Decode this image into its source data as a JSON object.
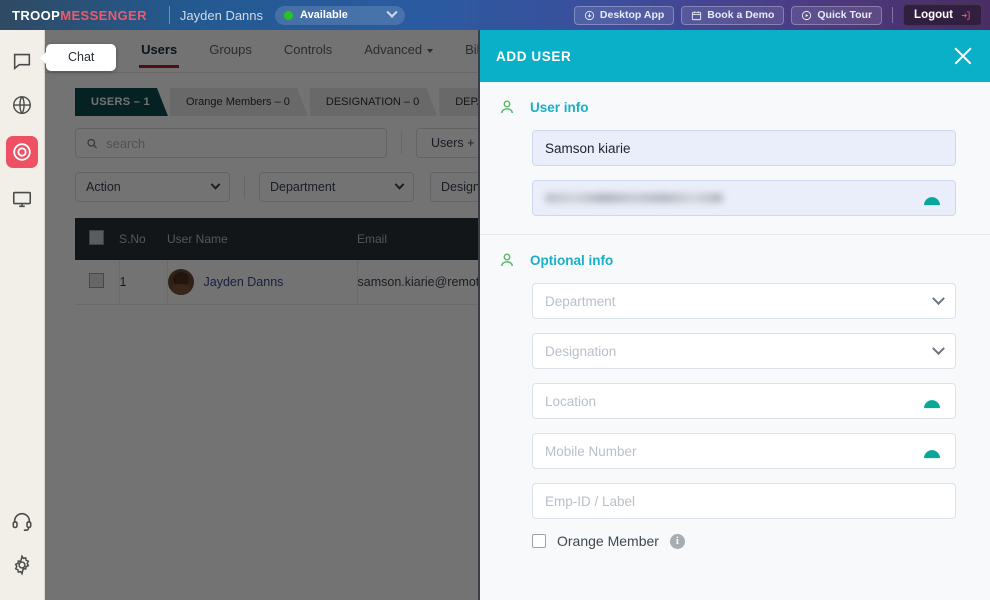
{
  "topbar": {
    "brand_first": "TROOP",
    "brand_second": "MESSENGER",
    "user_name": "Jayden Danns",
    "status": "Available",
    "status_dot_color": "#24c424",
    "buttons": [
      {
        "label": "Desktop App",
        "icon": "download-circle-icon"
      },
      {
        "label": "Book a Demo",
        "icon": "calendar-icon"
      },
      {
        "label": "Quick Tour",
        "icon": "play-circle-icon"
      }
    ],
    "logout_label": "Logout",
    "logout_icon": "logout-icon"
  },
  "rail": {
    "items": [
      {
        "name": "chat",
        "icon": "chat-bubble-icon",
        "active": false
      },
      {
        "name": "globe",
        "icon": "globe-icon",
        "active": false
      },
      {
        "name": "admin",
        "icon": "target-circle-icon",
        "active": true
      },
      {
        "name": "screen",
        "icon": "monitor-icon",
        "active": false
      }
    ],
    "bottom_items": [
      {
        "name": "support",
        "icon": "headset-icon"
      },
      {
        "name": "settings",
        "icon": "gear-icon"
      }
    ],
    "active_color": "#ee5064"
  },
  "tooltip": {
    "label": "Chat"
  },
  "tabs": [
    {
      "label": "Users",
      "active": true,
      "caret": false
    },
    {
      "label": "Groups",
      "active": false,
      "caret": false
    },
    {
      "label": "Controls",
      "active": false,
      "caret": false
    },
    {
      "label": "Advanced",
      "active": false,
      "caret": true
    },
    {
      "label": "Billing",
      "active": false,
      "caret": false
    }
  ],
  "subtabs": [
    {
      "label": "USERS – 1",
      "active": true
    },
    {
      "label": "Orange Members – 0",
      "active": false
    },
    {
      "label": "DESIGNATION – 0",
      "active": false
    },
    {
      "label": "DEPARTMENT –",
      "active": false
    }
  ],
  "filters": {
    "search_placeholder": "search",
    "search_value": "",
    "search_icon": "search-icon",
    "users_add_label": "Users +",
    "selects": [
      {
        "label": "Action"
      },
      {
        "label": "Department"
      },
      {
        "label": "Designation"
      }
    ]
  },
  "table": {
    "columns": [
      "",
      "S.No",
      "User Name",
      "Email"
    ],
    "rows": [
      {
        "sno": "1",
        "user_name": "Jayden Danns",
        "email": "samson.kiarie@remotew"
      }
    ]
  },
  "modal": {
    "title": "ADD USER",
    "header_color": "#0aafc8",
    "close_icon": "close-icon",
    "sections": [
      {
        "title": "User info",
        "icon": "person-icon",
        "fields": [
          {
            "name": "full-name",
            "value": "Samson kiarie",
            "placeholder": "",
            "type": "text",
            "filled": true
          },
          {
            "name": "email",
            "value": "",
            "placeholder": "",
            "type": "masked",
            "filled": true,
            "trailing_icon": "arch-caret-icon"
          }
        ]
      },
      {
        "title": "Optional info",
        "icon": "person-icon",
        "fields": [
          {
            "name": "department",
            "value": "",
            "placeholder": "Department",
            "type": "select",
            "filled": false,
            "trailing_icon": "chevron-down-icon"
          },
          {
            "name": "designation",
            "value": "",
            "placeholder": "Designation",
            "type": "select",
            "filled": false,
            "trailing_icon": "chevron-down-icon"
          },
          {
            "name": "location",
            "value": "",
            "placeholder": "Location",
            "type": "text",
            "filled": false,
            "trailing_icon": "arch-caret-icon"
          },
          {
            "name": "mobile-number",
            "value": "",
            "placeholder": "Mobile Number",
            "type": "text",
            "filled": false,
            "trailing_icon": "arch-caret-icon"
          },
          {
            "name": "emp-id",
            "value": "",
            "placeholder": "Emp-ID / Label",
            "type": "text",
            "filled": false,
            "trailing_icon": ""
          }
        ],
        "checkbox": {
          "label": "Orange Member",
          "checked": false,
          "info_icon": "info-icon",
          "info_glyph": "i"
        }
      }
    ]
  }
}
